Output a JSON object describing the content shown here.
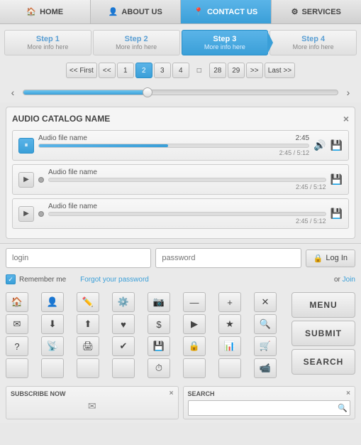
{
  "nav": {
    "items": [
      {
        "id": "home",
        "label": "HOME",
        "icon": "🏠",
        "active": false
      },
      {
        "id": "about",
        "label": "ABOUT US",
        "icon": "👤",
        "active": false
      },
      {
        "id": "contact",
        "label": "CONTACT US",
        "icon": "📍",
        "active": true
      },
      {
        "id": "services",
        "label": "SERVICES",
        "icon": "⚙",
        "active": false
      }
    ]
  },
  "steps": [
    {
      "id": "step1",
      "title": "Step 1",
      "sub": "More info here",
      "active": false
    },
    {
      "id": "step2",
      "title": "Step 2",
      "sub": "More info here",
      "active": false
    },
    {
      "id": "step3",
      "title": "Step 3",
      "sub": "More info here",
      "active": true
    },
    {
      "id": "step4",
      "title": "Step 4",
      "sub": "More info here",
      "active": false
    }
  ],
  "pagination": {
    "first_label": "<< First",
    "prev_label": "<<",
    "next_label": ">>",
    "last_label": "Last >>",
    "pages": [
      "1",
      "2",
      "3",
      "4",
      "...",
      "28",
      "29"
    ],
    "active_page": "2"
  },
  "audio": {
    "catalog_title": "AUDIO CATALOG NAME",
    "close_label": "×",
    "tracks": [
      {
        "name": "Audio file name",
        "time": "2:45",
        "duration": "2:45 / 5:12",
        "playing": true,
        "progress": 48
      },
      {
        "name": "Audio file name",
        "time": "",
        "duration": "2:45 / 5:12",
        "playing": false,
        "progress": 0
      },
      {
        "name": "Audio file name",
        "time": "",
        "duration": "2:45 / 5:12",
        "playing": false,
        "progress": 0
      }
    ]
  },
  "login": {
    "login_placeholder": "login",
    "password_placeholder": "password",
    "login_btn": "Log In",
    "lock_icon": "🔒",
    "remember_label": "Remember me",
    "forgot_label": "Forgot your password",
    "or_label": "or",
    "join_label": "Join"
  },
  "icons": {
    "grid": [
      "🏠",
      "👤",
      "✏️",
      "⚙️",
      "📷",
      "➖",
      "➕",
      "✕",
      "✉️",
      "⬇️",
      "⬆️",
      "❤️",
      "💲",
      "▶️",
      "★",
      "🔍",
      "❓",
      "📡",
      "🖨️",
      "✔️",
      "💾",
      "🔒",
      "📊",
      "🛒",
      "",
      "",
      "",
      "",
      "⏱️",
      "",
      "",
      "📹"
    ],
    "right_buttons": [
      "MENU",
      "SUBMIT",
      "SEARCH"
    ]
  },
  "bottom": {
    "subscribe_label": "SUBSCRIBE NOW",
    "search_label": "SEARCH",
    "close_label": "×",
    "subscribe_placeholder": "",
    "search_placeholder": ""
  }
}
